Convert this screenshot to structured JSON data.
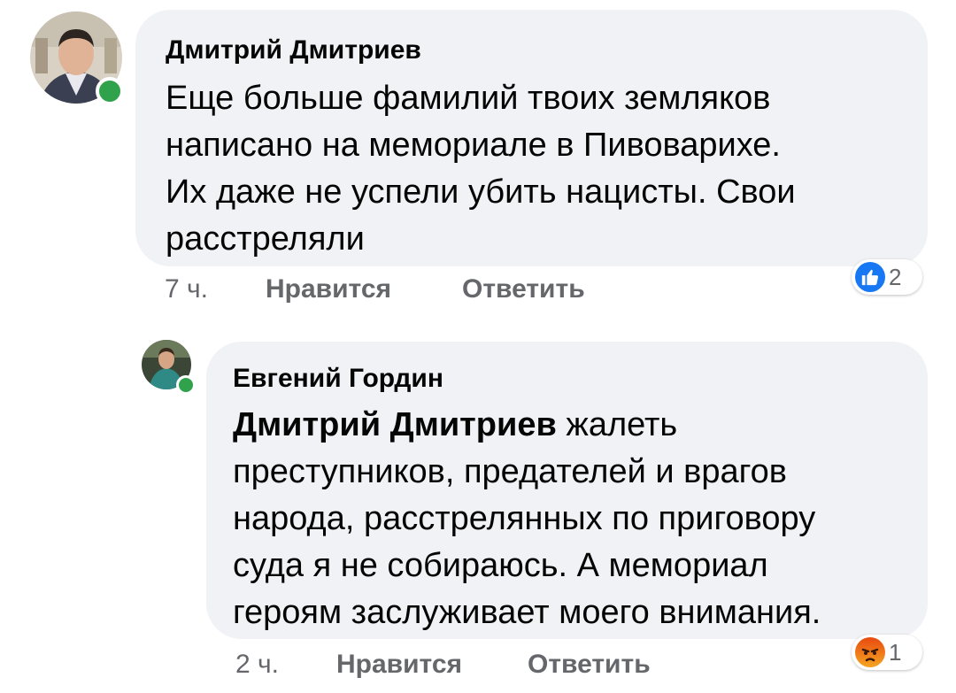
{
  "comments": [
    {
      "author": "Дмитрий Дмитриев",
      "text_lines": [
        "Еще больше фамилий твоих земляков",
        "написано на мемориале в Пивоварихе.",
        "Их даже не успели убить нацисты. Свои",
        "расстреляли"
      ],
      "time": "7 ч.",
      "like_label": "Нравится",
      "reply_label": "Ответить",
      "reaction": {
        "icon": "like-icon",
        "count": "2",
        "color": "#1877f2"
      },
      "online": true
    },
    {
      "author": "Евгений Гордин",
      "mention": "Дмитрий Дмитриев",
      "first_line_rest": " жалеть",
      "text_lines": [
        "преступников, предателей и врагов",
        "народа, расстрелянных по приговору",
        "суда я не собираюсь. А мемориал",
        "героям заслуживает моего внимания."
      ],
      "time": "2 ч.",
      "like_label": "Нравится",
      "reply_label": "Ответить",
      "reaction": {
        "icon": "angry-icon",
        "count": "1",
        "color": "#e9710f"
      },
      "online": true
    }
  ]
}
